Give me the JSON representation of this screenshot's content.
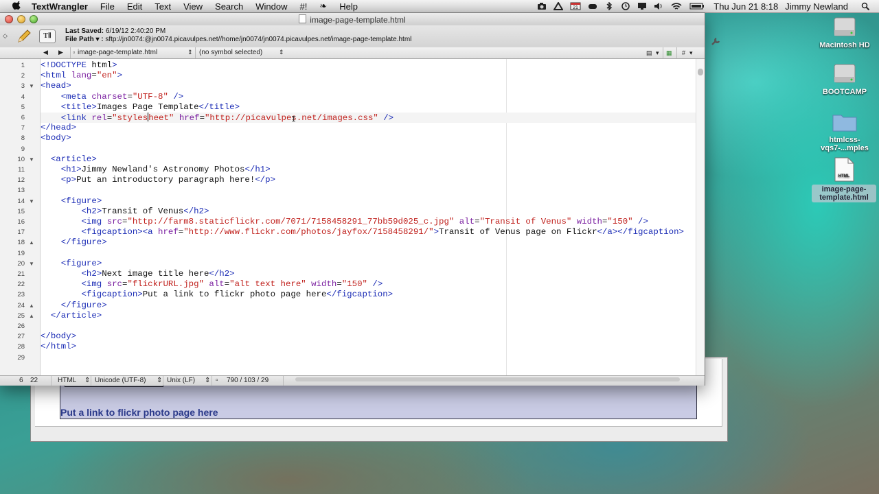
{
  "menubar": {
    "app": "TextWrangler",
    "items": [
      "File",
      "Edit",
      "Text",
      "View",
      "Search",
      "Window",
      "#!",
      "Help"
    ],
    "calendar_badge": "21",
    "clock": "Thu Jun 21  8:18",
    "user": "Jimmy Newland"
  },
  "window": {
    "title": "image-page-template.html",
    "last_saved_label": "Last Saved:",
    "last_saved_value": "6/19/12 2:40:20 PM",
    "file_path_label": "File Path ▾ :",
    "file_path_value": "sftp://jn0074:@jn0074.picavulpes.net//home/jn0074/jn0074.picavulpes.net/image-page-template.html",
    "text_button": "TⅡ"
  },
  "navbar": {
    "file": "image-page-template.html",
    "symbol": "(no symbol selected)",
    "hash": "#"
  },
  "code_lines": [
    "<!DOCTYPE html>",
    "<html lang=\"en\">",
    "<head>",
    "    <meta charset=\"UTF-8\" />",
    "    <title>Images Page Template</title>",
    "    <link rel=\"stylesheet\" href=\"http://picavulpes.net/images.css\" />",
    "</head>",
    "<body>",
    "",
    "  <article>",
    "    <h1>Jimmy Newland's Astronomy Photos</h1>",
    "    <p>Put an introductory paragraph here!</p>",
    "",
    "    <figure>",
    "        <h2>Transit of Venus</h2>",
    "        <img src=\"http://farm8.staticflickr.com/7071/7158458291_77bb59d025_c.jpg\" alt=\"Transit of Venus\" width=\"150\" />",
    "        <figcaption><a href=\"http://www.flickr.com/photos/jayfox/7158458291/\">Transit of Venus page on Flickr</a></figcaption>",
    "    </figure>",
    "",
    "    <figure>",
    "        <h2>Next image title here</h2>",
    "        <img src=\"flickrURL.jpg\" alt=\"alt text here\" width=\"150\" />",
    "        <figcaption>Put a link to flickr photo page here</figcaption>",
    "    </figure>",
    "  </article>",
    "",
    "</body>",
    "</html>",
    ""
  ],
  "line_numbers": [
    "1",
    "2",
    "3",
    "4",
    "5",
    "6",
    "7",
    "8",
    "9",
    "10",
    "11",
    "12",
    "13",
    "14",
    "15",
    "16",
    "17",
    "18",
    "19",
    "20",
    "21",
    "22",
    "23",
    "24",
    "25",
    "26",
    "27",
    "28",
    "29"
  ],
  "statusbar": {
    "line": "6",
    "col": "22",
    "language": "HTML",
    "encoding": "Unicode (UTF-8)",
    "line_endings": "Unix (LF)",
    "counts": "790 / 103 / 29"
  },
  "background_window": {
    "caption": "Put a link to flickr photo page here"
  },
  "desktop": {
    "icons": [
      {
        "label": "Macintosh HD",
        "icon": "hard-drive-icon"
      },
      {
        "label": "BOOTCAMP",
        "icon": "hard-drive-icon"
      },
      {
        "label": "htmlcss-\nvqs7-...mples",
        "icon": "folder-icon"
      },
      {
        "label": "image-page-\ntemplate.html",
        "icon": "html-file-icon"
      }
    ]
  }
}
